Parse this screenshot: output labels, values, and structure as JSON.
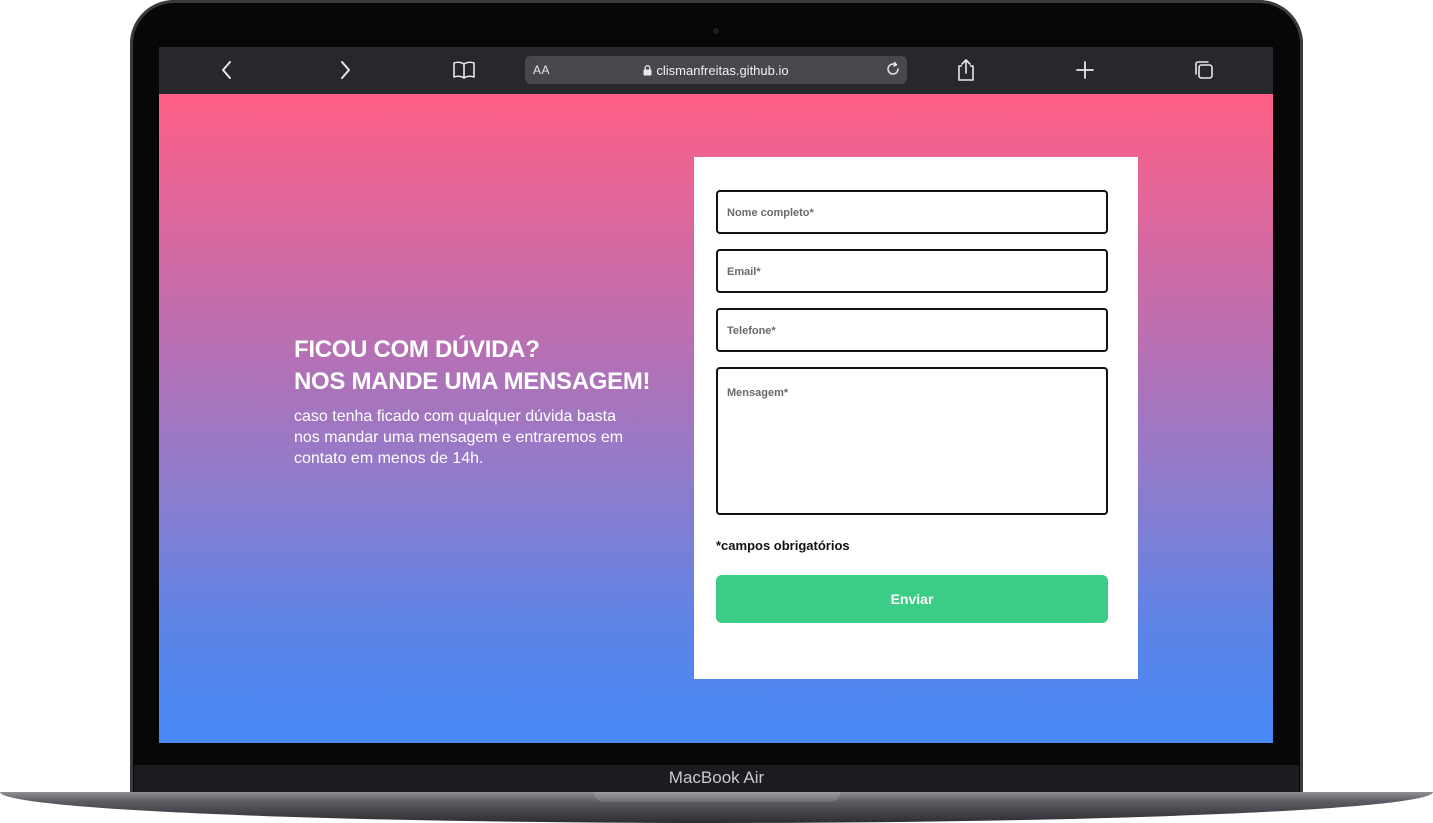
{
  "device": {
    "model_label": "MacBook Air"
  },
  "browser": {
    "text_size_label": "AA",
    "url": "clismanfreitas.github.io",
    "icons": {
      "back": "chevron-left-icon",
      "forward": "chevron-right-icon",
      "bookmarks": "book-icon",
      "lock": "lock-icon",
      "reload": "reload-icon",
      "share": "share-icon",
      "new_tab": "plus-icon",
      "tabs": "tabs-icon"
    }
  },
  "hero": {
    "title_line1": "FICOU COM DÚVIDA?",
    "title_line2": "NOS MANDE UMA MENSAGEM!",
    "text": "caso tenha ficado com qualquer dúvida basta nos mandar uma mensagem e entraremos em contato em menos de 14h."
  },
  "form": {
    "name_placeholder": "Nome completo*",
    "email_placeholder": "Email*",
    "phone_placeholder": "Telefone*",
    "message_placeholder": "Mensagem*",
    "required_note": "*campos obrigatórios",
    "submit_label": "Enviar"
  },
  "colors": {
    "gradient_top": "#ff5f86",
    "gradient_bottom": "#4689f7",
    "submit_button": "#3bcc86",
    "browser_bar": "#26282c"
  }
}
